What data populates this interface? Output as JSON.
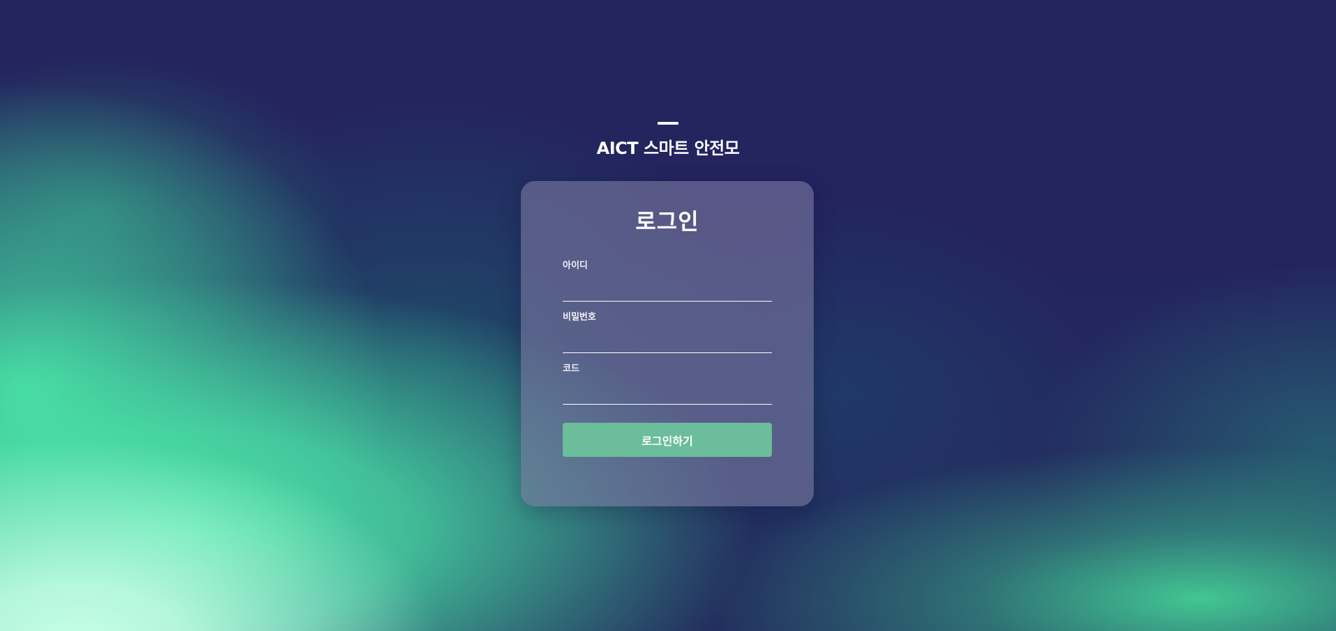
{
  "brand": {
    "title": "AICT 스마트 안전모"
  },
  "login": {
    "title": "로그인",
    "fields": [
      {
        "label": "아이디",
        "value": "",
        "type": "text"
      },
      {
        "label": "비밀번호",
        "value": "",
        "type": "password"
      },
      {
        "label": "코드",
        "value": "",
        "type": "text"
      }
    ],
    "submit_label": "로그인하기"
  },
  "colors": {
    "background": "#24245e",
    "aurora_green": "#4ce8aa",
    "card": "#7978a0",
    "button": "#6bbd9c",
    "text": "#ffffff"
  }
}
